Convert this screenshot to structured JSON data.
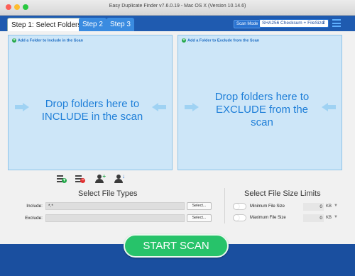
{
  "window": {
    "title": "Easy Duplicate Finder v7.6.0.19 - Mac OS X (Version 10.14.6)"
  },
  "tabs": [
    {
      "label": "Step 1: Select Folders",
      "active": true
    },
    {
      "label": "Step 2",
      "active": false
    },
    {
      "label": "Step 3",
      "active": false
    }
  ],
  "scan_mode": {
    "label": "Scan Mode",
    "value": "SHA256 Checksum + FileSize"
  },
  "include_panel": {
    "header": "Add a Folder to Include in the Scan",
    "message": "Drop folders here to INCLUDE in the scan"
  },
  "exclude_panel": {
    "header": "Add a Folder to Exclude from the Scan",
    "message": "Drop folders here to EXCLUDE from the scan"
  },
  "file_types": {
    "title": "Select File Types",
    "include_label": "Include:",
    "include_value": "*.*",
    "exclude_label": "Exclude:",
    "exclude_value": "",
    "select_label": "Select..."
  },
  "size_limits": {
    "title": "Select File Size Limits",
    "min_label": "Minimum File Size",
    "min_value": "0",
    "max_label": "Maximum File Size",
    "max_value": "0",
    "unit": "KB"
  },
  "start_button": "START SCAN",
  "colors": {
    "accent": "#1f5bb0",
    "start": "#27c36a",
    "drop_bg": "#cde6f8",
    "drop_text": "#1f7fd8"
  }
}
